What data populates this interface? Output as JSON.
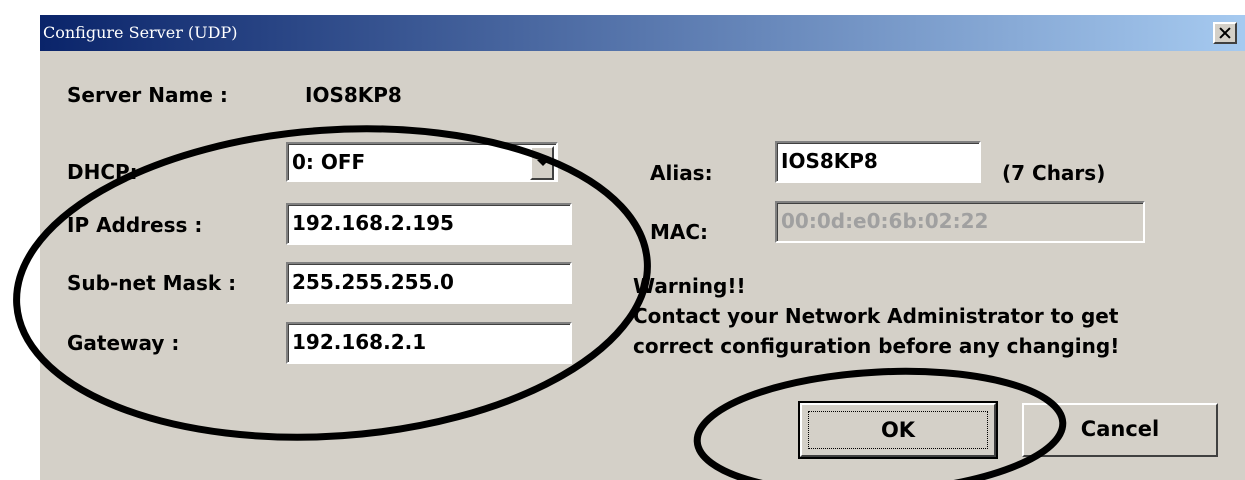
{
  "window": {
    "title": "Configure Server (UDP)"
  },
  "server_name": {
    "label": "Server Name :",
    "value": "IOS8KP8"
  },
  "dhcp": {
    "label": "DHCP:",
    "value": "0: OFF"
  },
  "ip_address": {
    "label": "IP Address :",
    "value": "192.168.2.195"
  },
  "subnet_mask": {
    "label": "Sub-net Mask :",
    "value": "255.255.255.0"
  },
  "gateway": {
    "label": "Gateway :",
    "value": "192.168.2.1"
  },
  "alias": {
    "label": "Alias:",
    "value": "IOS8KP8",
    "hint": "(7 Chars)"
  },
  "mac": {
    "label": "MAC:",
    "value": "00:0d:e0:6b:02:22"
  },
  "warning": {
    "title": "Warning!!",
    "line1": "Contact your Network Administrator to get",
    "line2": "correct  configuration before any changing!"
  },
  "buttons": {
    "ok": "OK",
    "cancel": "Cancel"
  },
  "colors": {
    "title_bar_start": "#0a246a",
    "title_bar_end": "#a6caf0",
    "dialog_bg": "#d4d0c8",
    "annotation": "#000000"
  }
}
